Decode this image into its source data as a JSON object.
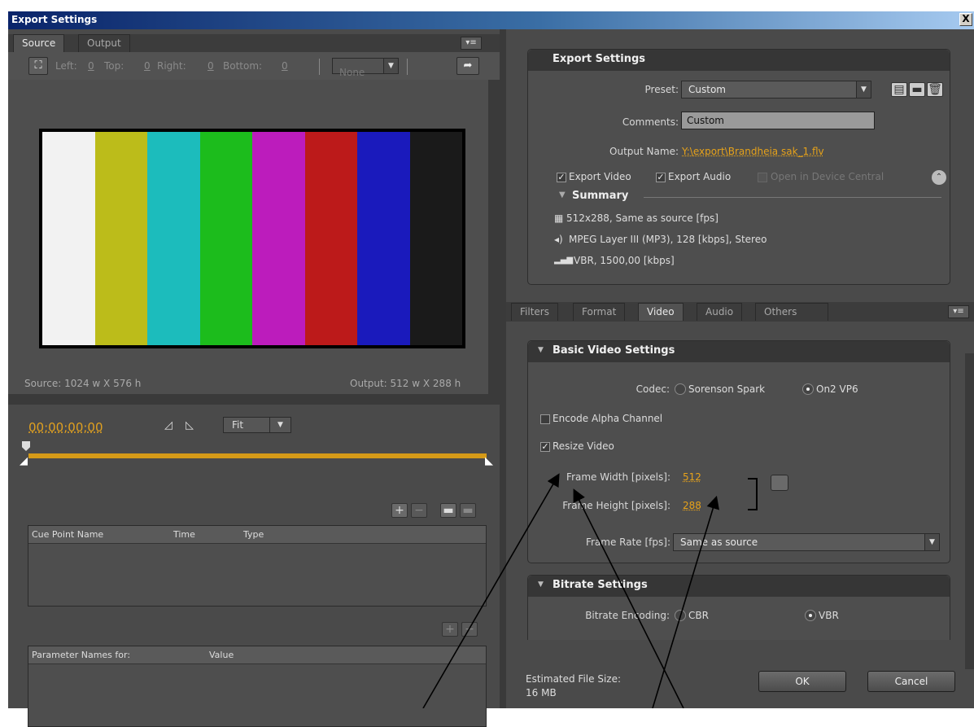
{
  "window": {
    "title": "Export Settings",
    "close": "X"
  },
  "left": {
    "tabs": [
      "Source",
      "Output"
    ],
    "crop": {
      "left_label": "Left:",
      "left_val": "0",
      "top_label": "Top:",
      "top_val": "0",
      "right_label": "Right:",
      "right_val": "0",
      "bottom_label": "Bottom:",
      "bottom_val": "0",
      "ratio": "None"
    },
    "colorbars": [
      "#f2f2f2",
      "#bcbc1a",
      "#1cbcbc",
      "#1cbc1c",
      "#bc1cbc",
      "#bc1a1a",
      "#1a1abc",
      "#1a1a1a"
    ],
    "source_dims": "Source: 1024 w X 576 h",
    "output_dims": "Output: 512 w X 288 h",
    "timecode": "00;00;00;00",
    "fit": "Fit",
    "cue_headers": [
      "Cue Point Name",
      "Time",
      "Type"
    ],
    "param_headers": [
      "Parameter Names for:",
      "Value"
    ]
  },
  "export": {
    "header": "Export Settings",
    "preset_label": "Preset:",
    "preset": "Custom",
    "comments_label": "Comments:",
    "comments": "Custom",
    "output_label": "Output Name:",
    "output_name": "Y:\\export\\Brandheia sak_1.flv",
    "export_video": "Export Video",
    "export_audio": "Export Audio",
    "device_central": "Open in Device Central",
    "summary_label": "Summary",
    "summary": [
      "512x288, Same as source [fps]",
      "MPEG Layer III (MP3), 128 [kbps], Stereo",
      "VBR, 1500,00 [kbps]"
    ]
  },
  "tabs": [
    "Filters",
    "Format",
    "Video",
    "Audio",
    "Others"
  ],
  "video": {
    "header": "Basic Video Settings",
    "codec_label": "Codec:",
    "codec_opts": [
      "Sorenson Spark",
      "On2 VP6"
    ],
    "alpha": "Encode Alpha Channel",
    "resize": "Resize Video",
    "width_label": "Frame Width [pixels]:",
    "width": "512",
    "height_label": "Frame Height [pixels]:",
    "height": "288",
    "rate_label": "Frame Rate [fps]:",
    "rate": "Same as source"
  },
  "bitrate": {
    "header": "Bitrate Settings",
    "enc_label": "Bitrate Encoding:",
    "opts": [
      "CBR",
      "VBR"
    ]
  },
  "footer": {
    "size_label": "Estimated File Size:",
    "size": "16 MB",
    "ok": "OK",
    "cancel": "Cancel"
  }
}
